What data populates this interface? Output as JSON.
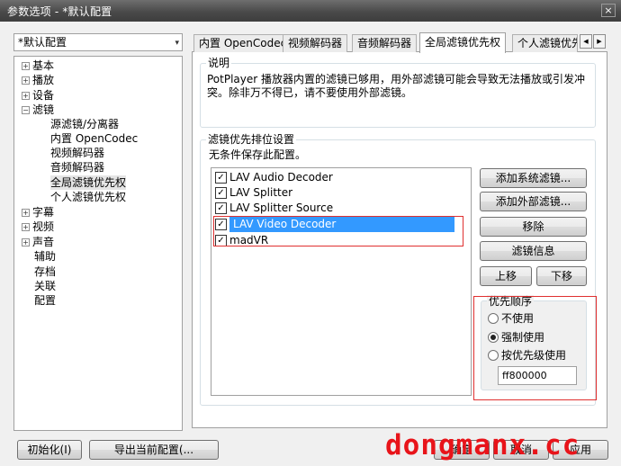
{
  "window": {
    "title": "参数选项 - *默认配置",
    "close_glyph": "×"
  },
  "profile": {
    "value": "*默认配置",
    "arrow": "▾"
  },
  "tree": {
    "items": [
      {
        "label": "基本",
        "expander": "+"
      },
      {
        "label": "播放",
        "expander": "+"
      },
      {
        "label": "设备",
        "expander": "+"
      },
      {
        "label": "滤镜",
        "expander": "−"
      },
      {
        "label": "源滤镜/分离器"
      },
      {
        "label": "内置 OpenCodec"
      },
      {
        "label": "视频解码器"
      },
      {
        "label": "音频解码器"
      },
      {
        "label": "全局滤镜优先权",
        "selected": true
      },
      {
        "label": "个人滤镜优先权"
      },
      {
        "label": "字幕",
        "expander": "+"
      },
      {
        "label": "视频",
        "expander": "+"
      },
      {
        "label": "声音",
        "expander": "+"
      },
      {
        "label": "辅助"
      },
      {
        "label": "存档"
      },
      {
        "label": "关联"
      },
      {
        "label": "配置"
      }
    ]
  },
  "tabs": [
    {
      "label": "内置 OpenCodec"
    },
    {
      "label": "视频解码器"
    },
    {
      "label": "音频解码器"
    },
    {
      "label": "全局滤镜优先权",
      "active": true
    },
    {
      "label": "个人滤镜优先"
    }
  ],
  "tab_scroll": {
    "left": "◀",
    "right": "▶"
  },
  "description": {
    "title": "说明",
    "line1": "PotPlayer 播放器内置的滤镜已够用，用外部滤镜可能会导致无法播放或引发冲",
    "line2": "突。除非万不得已，请不要使用外部滤镜。"
  },
  "filter_priority": {
    "title": "滤镜优先排位设置",
    "subtitle": "无条件保存此配置。",
    "filters": [
      {
        "name": "LAV Audio Decoder",
        "checked": true
      },
      {
        "name": "LAV Splitter",
        "checked": true
      },
      {
        "name": "LAV Splitter Source",
        "checked": true
      },
      {
        "name": "LAV Video Decoder",
        "checked": true,
        "selected": true
      },
      {
        "name": "madVR",
        "checked": true
      }
    ],
    "check_glyph": "✓",
    "buttons": {
      "add_system": "添加系统滤镜...",
      "add_external": "添加外部滤镜...",
      "remove": "移除",
      "info": "滤镜信息",
      "move_up": "上移",
      "move_down": "下移"
    }
  },
  "priority_order": {
    "title": "优先顺序",
    "options": [
      {
        "label": "不使用",
        "selected": false
      },
      {
        "label": "强制使用",
        "selected": true
      },
      {
        "label": "按优先级使用",
        "selected": false
      }
    ],
    "merit_value": "ff800000"
  },
  "footer": {
    "init_button": "初始化(I)",
    "export_button": "导出当前配置(...",
    "ok_button": "确定",
    "cancel_button": "取消",
    "apply_button": "应用"
  },
  "watermark": "dongmanx.cc",
  "colors": {
    "selection": "#3399ff",
    "highlight_box": "#e03030",
    "watermark": "#e8141a"
  }
}
